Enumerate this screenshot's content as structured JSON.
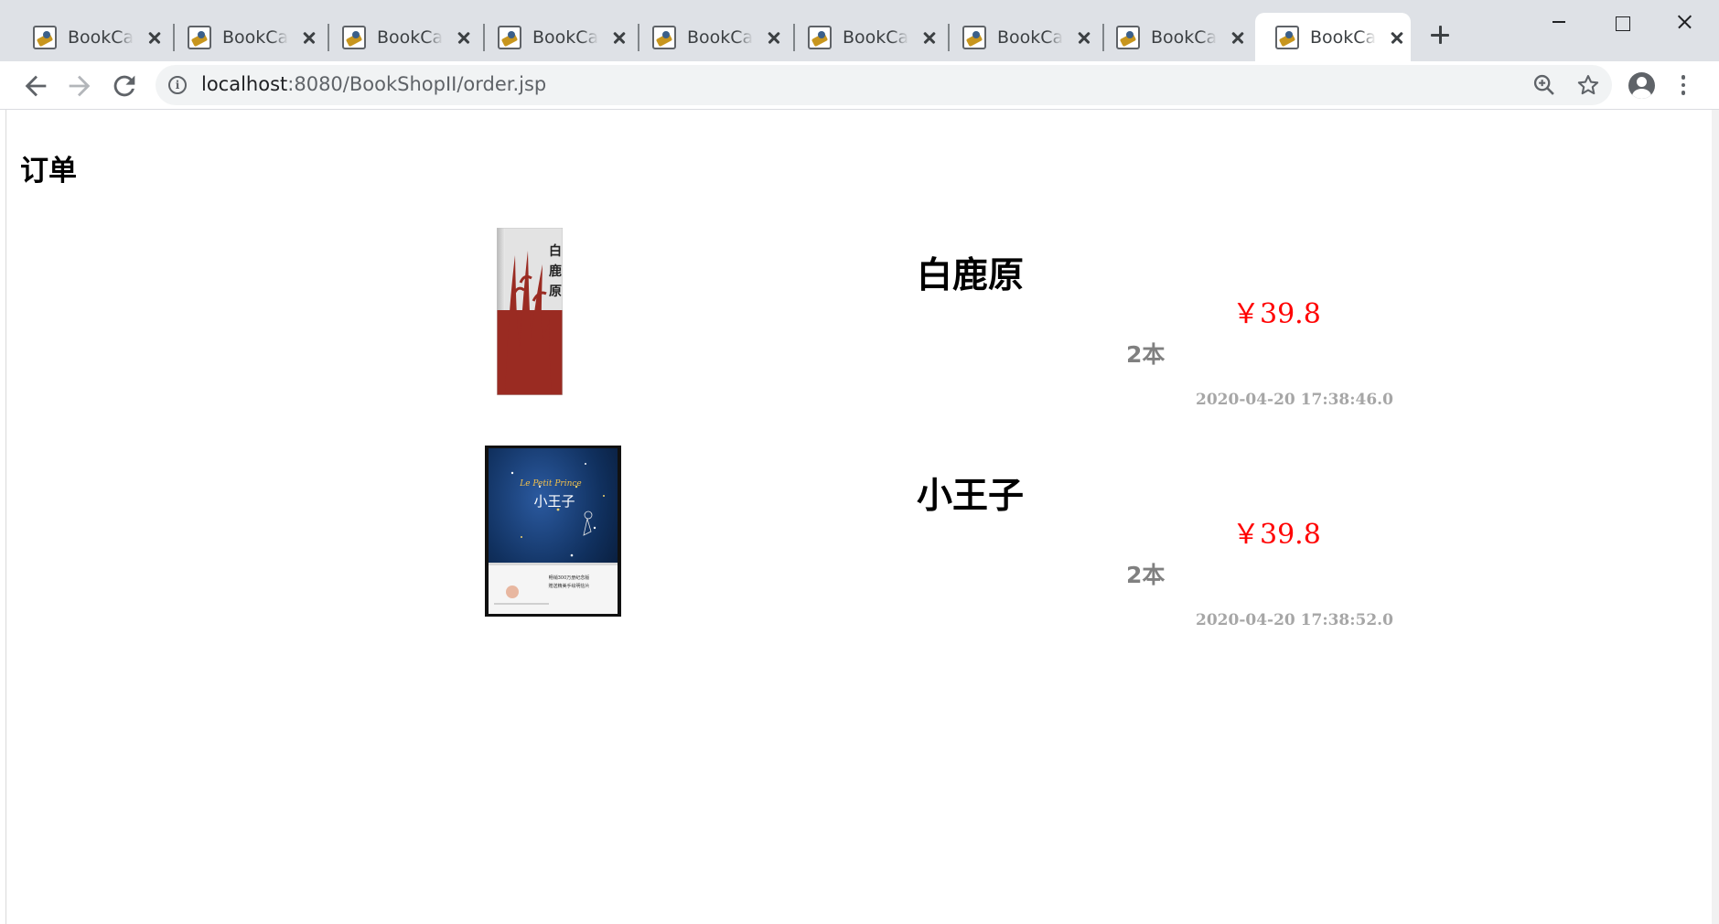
{
  "browser": {
    "tabs": [
      {
        "title": "BookCar"
      },
      {
        "title": "BookCar"
      },
      {
        "title": "BookCar"
      },
      {
        "title": "BookCar"
      },
      {
        "title": "BookCar"
      },
      {
        "title": "BookCar"
      },
      {
        "title": "BookCar"
      },
      {
        "title": "BookCar"
      },
      {
        "title": "BookCar",
        "active": true
      }
    ],
    "url_host": "localhost",
    "url_rest": ":8080/BookShopII/order.jsp",
    "icons": [
      "back-icon",
      "forward-icon",
      "reload-icon",
      "info-icon",
      "zoom-icon",
      "star-icon",
      "account-icon",
      "menu-icon"
    ]
  },
  "page": {
    "title": "订单",
    "orders": [
      {
        "name": "白鹿原",
        "price": "￥39.8",
        "quantity": "2本",
        "time": "2020-04-20 17:38:46.0",
        "cover_text": "白鹿原"
      },
      {
        "name": "小王子",
        "price": "￥39.8",
        "quantity": "2本",
        "time": "2020-04-20 17:38:52.0",
        "cover_text": "小王子",
        "cover_subtitle": "Le Petit Prince"
      }
    ]
  },
  "colors": {
    "price": "#ff0000",
    "quantity": "#808080",
    "time": "#a6a6a6",
    "tabstrip": "#dee1e6",
    "omnibox": "#f1f3f4"
  }
}
